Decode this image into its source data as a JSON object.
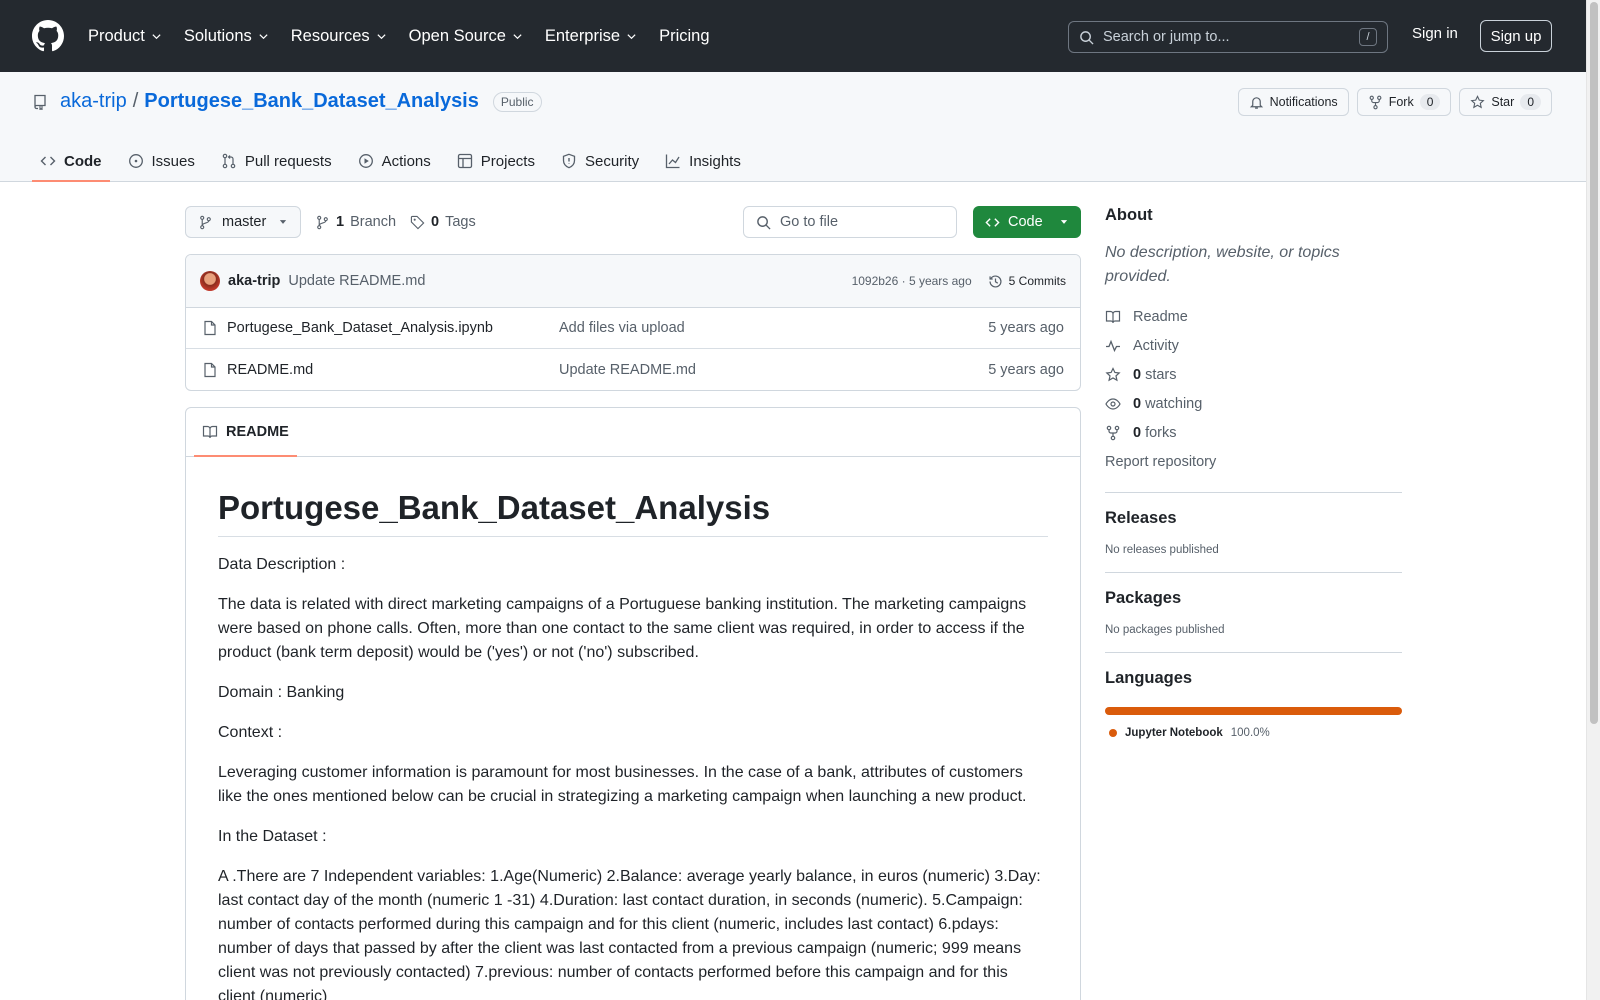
{
  "header": {
    "nav": [
      {
        "label": "Product",
        "has_menu": true
      },
      {
        "label": "Solutions",
        "has_menu": true
      },
      {
        "label": "Resources",
        "has_menu": true
      },
      {
        "label": "Open Source",
        "has_menu": true
      },
      {
        "label": "Enterprise",
        "has_menu": true
      },
      {
        "label": "Pricing",
        "has_menu": false
      }
    ],
    "search_placeholder": "Search or jump to...",
    "search_shortcut": "/",
    "sign_in": "Sign in",
    "sign_up": "Sign up"
  },
  "repo": {
    "owner": "aka-trip",
    "separator": "/",
    "name": "Portugese_Bank_Dataset_Analysis",
    "visibility": "Public",
    "actions": {
      "notifications": "Notifications",
      "fork": "Fork",
      "fork_count": "0",
      "star": "Star",
      "star_count": "0"
    },
    "tabs": [
      {
        "label": "Code",
        "icon": "code-icon",
        "active": true
      },
      {
        "label": "Issues",
        "icon": "issue-icon",
        "active": false
      },
      {
        "label": "Pull requests",
        "icon": "pull-request-icon",
        "active": false
      },
      {
        "label": "Actions",
        "icon": "play-icon",
        "active": false
      },
      {
        "label": "Projects",
        "icon": "table-icon",
        "active": false
      },
      {
        "label": "Security",
        "icon": "shield-icon",
        "active": false
      },
      {
        "label": "Insights",
        "icon": "graph-icon",
        "active": false
      }
    ]
  },
  "toolbar": {
    "branch": "master",
    "branch_count": "1",
    "branch_label": "Branch",
    "tag_count": "0",
    "tag_label": "Tags",
    "goto_placeholder": "Go to file",
    "code_button": "Code"
  },
  "commit": {
    "author": "aka-trip",
    "message": "Update README.md",
    "meta": "1092b26 · 5 years ago",
    "commits_label": "5 Commits"
  },
  "files": [
    {
      "name": "Portugese_Bank_Dataset_Analysis.ipynb",
      "message": "Add files via upload",
      "date": "5 years ago"
    },
    {
      "name": "README.md",
      "message": "Update README.md",
      "date": "5 years ago"
    }
  ],
  "readme": {
    "tab_label": "README",
    "title": "Portugese_Bank_Dataset_Analysis",
    "paragraphs": [
      "Data Description :",
      "The data is related with direct marketing campaigns of a Portuguese banking institution. The marketing campaigns were based on phone calls. Often, more than one contact to the same client was required, in order to access if the product (bank term deposit) would be ('yes') or not ('no') subscribed.",
      "Domain : Banking",
      "Context :",
      "Leveraging customer information is paramount for most businesses. In the case of a bank, attributes of customers like the ones mentioned below can be crucial in strategizing a marketing campaign when launching a new product.",
      "In the Dataset :",
      "A .There are 7 Independent variables: 1.Age(Numeric) 2.Balance: average yearly balance, in euros (numeric) 3.Day: last contact day of the month (numeric 1 -31) 4.Duration: last contact duration, in seconds (numeric). 5.Campaign: number of contacts performed during this campaign and for this client (numeric, includes last contact) 6.pdays: number of days that passed by after the client was last contacted from a previous campaign (numeric; 999 means client was not previously contacted) 7.previous: number of contacts performed before this campaign and for this client (numeric)"
    ]
  },
  "sidebar": {
    "about_title": "About",
    "about_desc": "No description, website, or topics provided.",
    "links": [
      {
        "icon": "book-icon",
        "count": "",
        "label": "Readme"
      },
      {
        "icon": "pulse-icon",
        "count": "",
        "label": "Activity"
      },
      {
        "icon": "star-icon",
        "count": "0",
        "label": "stars"
      },
      {
        "icon": "eye-icon",
        "count": "0",
        "label": "watching"
      },
      {
        "icon": "fork-icon",
        "count": "0",
        "label": "forks"
      }
    ],
    "report": "Report repository",
    "releases_title": "Releases",
    "releases_empty": "No releases published",
    "packages_title": "Packages",
    "packages_empty": "No packages published",
    "languages_title": "Languages",
    "languages": [
      {
        "name": "Jupyter Notebook",
        "percent": "100.0%",
        "color": "#da5b0b"
      }
    ]
  }
}
